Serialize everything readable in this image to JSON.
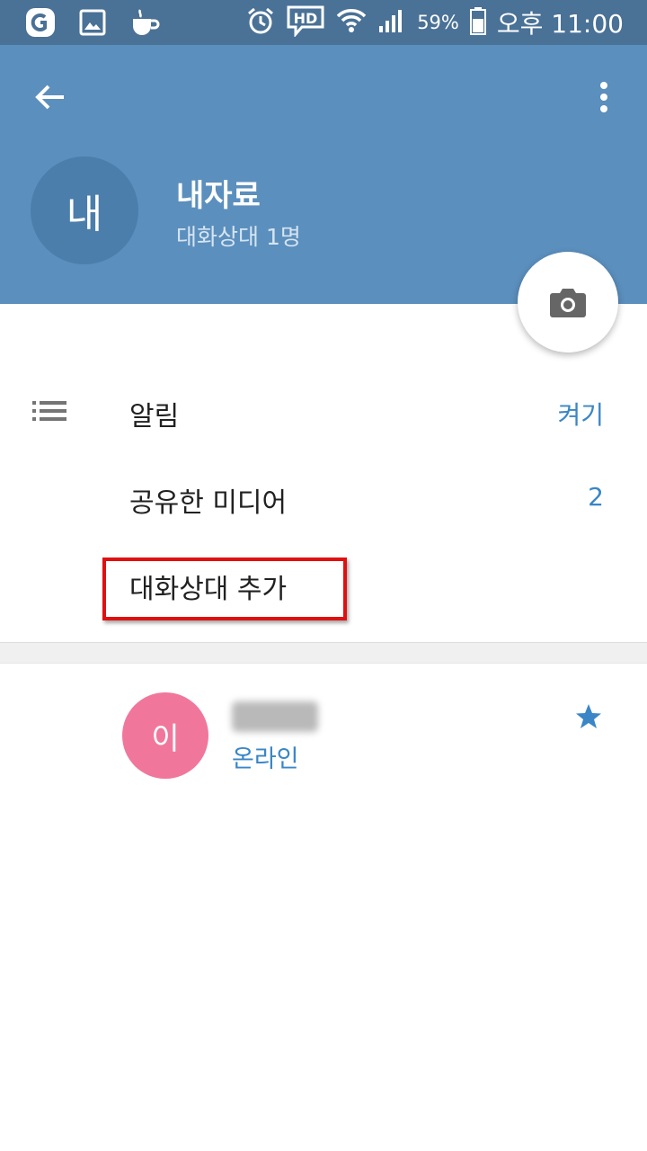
{
  "status_bar": {
    "battery_percent": "59%",
    "time": "오후 11:00",
    "hd_label": "HD",
    "icons": [
      "app-g-icon",
      "image-icon",
      "coffee-icon",
      "alarm-icon",
      "hd-voice-icon",
      "wifi-icon",
      "signal-icon",
      "battery-icon"
    ]
  },
  "header": {
    "back_icon": "arrow-back-icon",
    "menu_icon": "more-vert-icon",
    "avatar_letter": "내",
    "title": "내자료",
    "subtitle": "대화상대 1명",
    "camera_icon": "camera-icon",
    "background_color": "#5b8fbd"
  },
  "settings": {
    "notifications": {
      "icon": "list-icon",
      "label": "알림",
      "value": "켜기"
    },
    "shared_media": {
      "label": "공유한 미디어",
      "value": "2"
    },
    "add_contact": {
      "label": "대화상대 추가"
    }
  },
  "members": [
    {
      "avatar_letter": "이",
      "avatar_color": "#f0779b",
      "status": "온라인",
      "starred": true,
      "star_icon": "star-icon"
    }
  ],
  "colors": {
    "accent": "#3a86c6",
    "highlight": "#e01010"
  }
}
